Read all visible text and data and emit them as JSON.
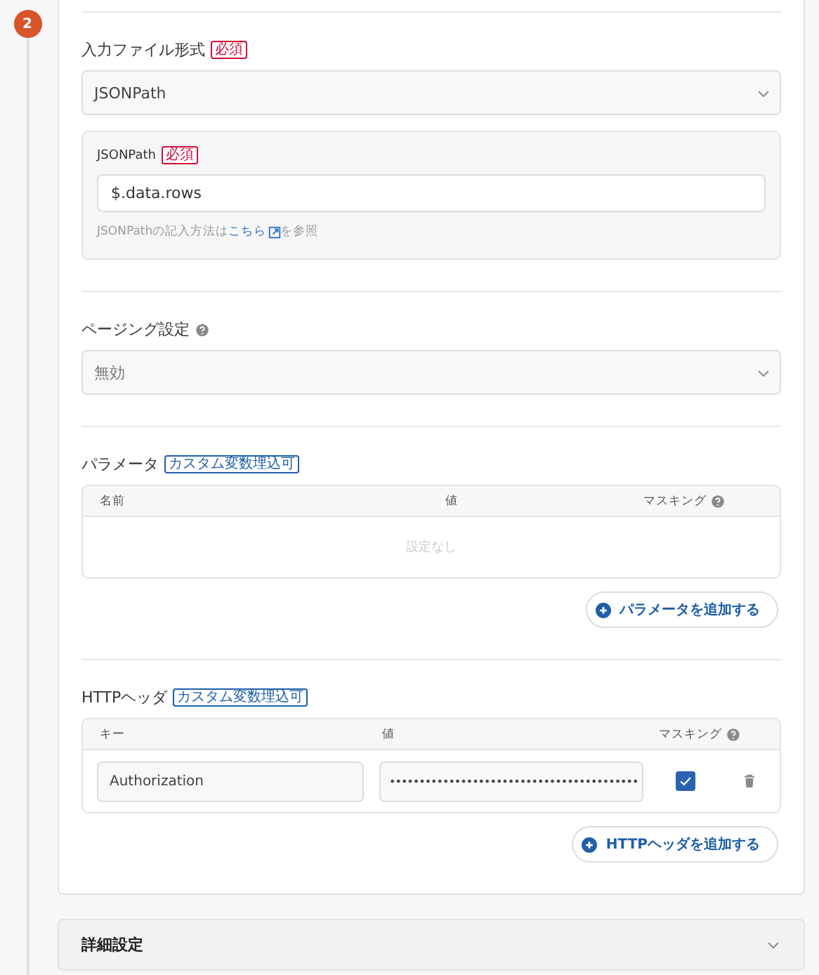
{
  "step_number": "2",
  "input_format": {
    "label": "入力ファイル形式",
    "required_badge": "必須",
    "value": "JSONPath",
    "jsonpath": {
      "label": "JSONPath",
      "required_badge": "必須",
      "value": "$.data.rows",
      "hint_before": "JSONPathの記入方法は",
      "hint_link": "こちら",
      "hint_after": "を参照"
    }
  },
  "paging": {
    "label": "ページング設定",
    "value": "無効"
  },
  "parameters": {
    "label": "パラメータ",
    "badge": "カスタム変数埋込可",
    "columns": [
      "名前",
      "値",
      "マスキング"
    ],
    "empty_text": "設定なし",
    "add_button": "パラメータを追加する"
  },
  "http_headers": {
    "label": "HTTPヘッダ",
    "badge": "カスタム変数埋込可",
    "columns": [
      "キー",
      "値",
      "マスキング"
    ],
    "rows": [
      {
        "key": "Authorization",
        "value": "••••••••••••••••••••••••••••••••••••••••••",
        "masked": true
      }
    ],
    "add_button": "HTTPヘッダを追加する"
  },
  "advanced": {
    "label": "詳細設定",
    "expanded": false
  }
}
